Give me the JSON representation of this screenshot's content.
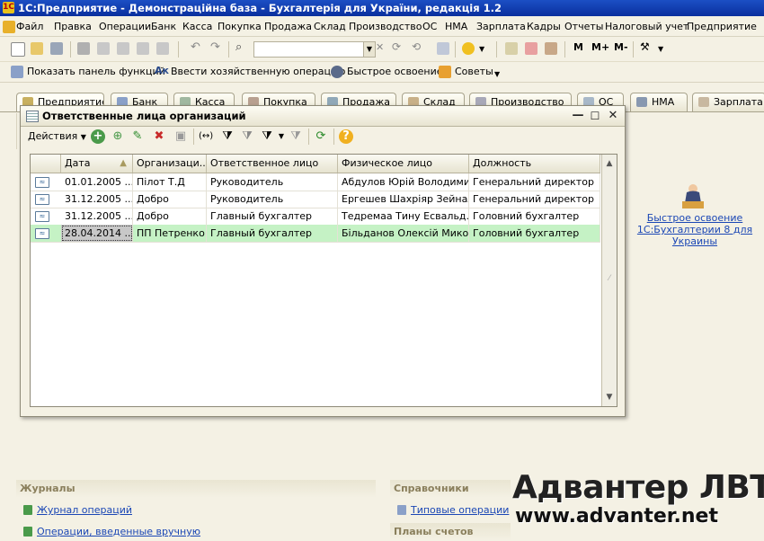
{
  "app": {
    "title": "1С:Предприятие - Демонстраційна база - Бухгалтерія для України, редакція 1.2"
  },
  "menu": {
    "items": [
      "Файл",
      "Правка",
      "Операции",
      "Банк",
      "Касса",
      "Покупка",
      "Продажа",
      "Склад",
      "Производство",
      "ОС",
      "НМА",
      "Зарплата",
      "Кадры",
      "Отчеты",
      "Налоговый учет",
      "Предприятие"
    ]
  },
  "toolbar": {
    "quick_labels": {
      "show_panel": "Показать панель функций",
      "enter_operation": "Ввести хозяйственную операцию",
      "quick_start": "Быстрое освоение",
      "tips": "Советы"
    },
    "search_value": "",
    "m_buttons": [
      "M",
      "M+",
      "M-"
    ]
  },
  "tabs": [
    "Предприятие",
    "Банк",
    "Касса",
    "Покупка",
    "Продажа",
    "Склад",
    "Производство",
    "ОС",
    "НМА",
    "Зарплата"
  ],
  "dialog": {
    "title": "Ответственные лица организаций",
    "actions_label": "Действия",
    "columns": [
      "Дата",
      "Организаци...",
      "Ответственное лицо",
      "Физическое лицо",
      "Должность"
    ],
    "rows": [
      [
        "01.01.2005 ...",
        "Пілот Т.Д",
        "Руководитель",
        "Абдулов Юрій Володимир...",
        "Генеральний директор"
      ],
      [
        "31.12.2005 ...",
        "Добро",
        "Руководитель",
        "Ергешев Шахріяр Зейнал...",
        "Генеральний директор"
      ],
      [
        "31.12.2005 ...",
        "Добро",
        "Главный бухгалтер",
        "Тедремаа Тину Есвальд...",
        "Головний бухгалтер"
      ],
      [
        "28.04.2014 ...",
        "ПП Петренко",
        "Главный бухгалтер",
        "Більданов Олексій Мико...",
        "Головний бухгалтер"
      ]
    ]
  },
  "quick_start": {
    "link": "Быстрое освоение 1С:Бухгалтерии 8 для Украины"
  },
  "sections": {
    "journals": {
      "title": "Журналы",
      "links": [
        "Журнал операций",
        "Операции, введенные вручную"
      ]
    },
    "references": {
      "title": "Справочники",
      "links": [
        "Типовые операции"
      ]
    },
    "charts": {
      "title": "Планы счетов"
    }
  },
  "watermark": {
    "line1": "Адвантер ЛВТИ",
    "line2": "www.advanter.net"
  },
  "colors": {
    "titlebar": "#0a2f9e",
    "panel_bg": "#f4f1e4",
    "selected_row": "#c5f2c5",
    "link": "#1b47b5"
  }
}
